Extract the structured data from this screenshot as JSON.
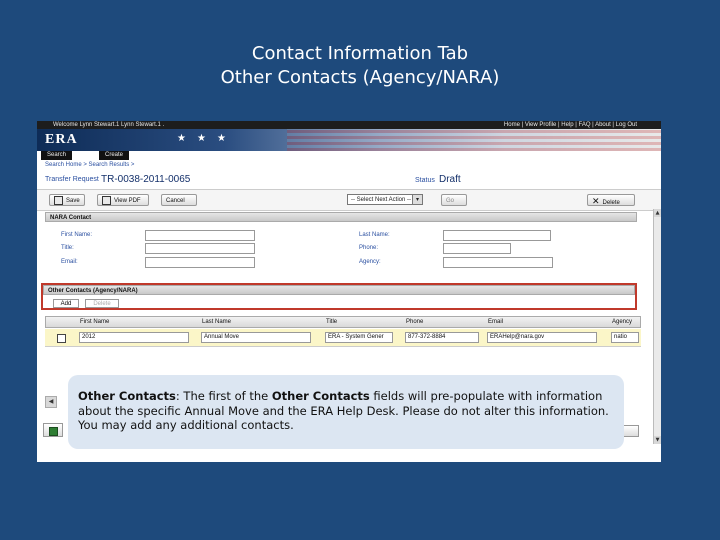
{
  "slide": {
    "title_line1": "Contact Information Tab",
    "title_line2": "Other Contacts (Agency/NARA)"
  },
  "app": {
    "welcome": "Welcome Lynn Stewart.1 Lynn Stewart.1 .",
    "top_links": "Home | View Profile | Help | FAQ | About | Log Out",
    "logo": "ERA",
    "nav_tabs": [
      "Search",
      "Create"
    ],
    "breadcrumb": "Search Home > Search Results >",
    "transfer_label": "Transfer Request",
    "transfer_number": "TR-0038-2011-0065",
    "status_label": "Status",
    "status_value": "Draft"
  },
  "toolbar": {
    "save": "Save",
    "view_pdf": "View PDF",
    "cancel": "Cancel",
    "next_action": "-- Select Next Action --",
    "go": "Go",
    "delete": "Delete"
  },
  "nara_contact": {
    "heading": "NARA Contact",
    "first_name_label": "First Name:",
    "title_label": "Title:",
    "email_label": "Email:",
    "last_name_label": "Last Name:",
    "phone_label": "Phone:",
    "agency_label": "Agency:"
  },
  "other_contacts": {
    "heading": "Other Contacts (Agency/NARA)",
    "add_tab": "Add",
    "delete_tab": "Delete",
    "columns": [
      "First Name",
      "Last Name",
      "Title",
      "Phone",
      "Email",
      "Agency"
    ],
    "rows": [
      {
        "first_name": "2012",
        "last_name": "Annual Move",
        "title": "ERA - System Gener",
        "phone": "877-372-8884",
        "email": "ERAHelp@nara.gov",
        "agency": "natio"
      }
    ]
  },
  "callout": {
    "lead": "Other Contacts",
    "t1": ": The first of the ",
    "bold2": "Other Contacts",
    "t2": " fields will pre-populate with information about the specific Annual Move and the ERA Help Desk. Please do not alter this information. You may add any additional contacts."
  }
}
